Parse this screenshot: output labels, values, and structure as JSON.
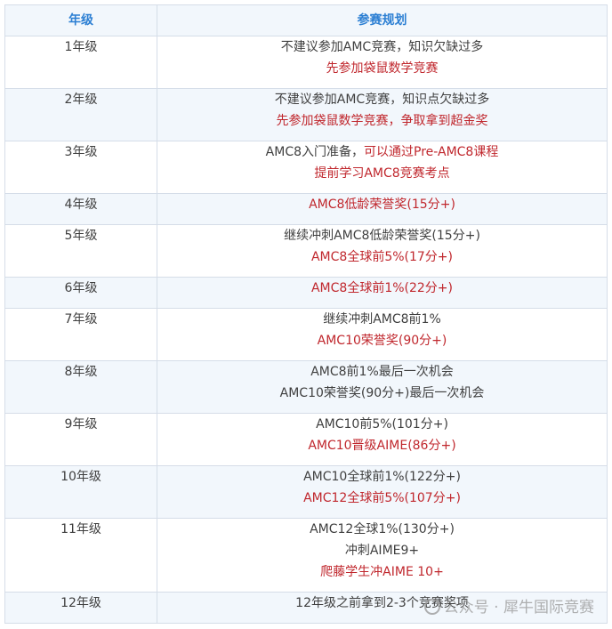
{
  "table": {
    "headers": [
      "年级",
      "参赛规划"
    ],
    "rows": [
      {
        "grade": "1年级",
        "lines": [
          {
            "parts": [
              {
                "text": "不建议参加AMC竞赛，知识欠缺过多",
                "red": false
              }
            ]
          },
          {
            "parts": [
              {
                "text": "先参加袋鼠数学竞赛",
                "red": true
              }
            ]
          }
        ]
      },
      {
        "grade": "2年级",
        "lines": [
          {
            "parts": [
              {
                "text": "不建议参加AMC竞赛，知识点欠缺过多",
                "red": false
              }
            ]
          },
          {
            "parts": [
              {
                "text": "先参加袋鼠数学竞赛，争取拿到超金奖",
                "red": true
              }
            ]
          }
        ]
      },
      {
        "grade": "3年级",
        "lines": [
          {
            "parts": [
              {
                "text": "AMC8入门准备，",
                "red": false
              },
              {
                "text": "可以通过Pre-AMC8课程",
                "red": true
              }
            ]
          },
          {
            "parts": [
              {
                "text": "提前学习AMC8竞赛考点",
                "red": true
              }
            ]
          }
        ]
      },
      {
        "grade": "4年级",
        "lines": [
          {
            "parts": [
              {
                "text": "AMC8低龄荣誉奖(15分+)",
                "red": true
              }
            ]
          }
        ]
      },
      {
        "grade": "5年级",
        "lines": [
          {
            "parts": [
              {
                "text": "继续冲刺AMC8低龄荣誉奖(15分+)",
                "red": false
              }
            ]
          },
          {
            "parts": [
              {
                "text": "AMC8全球前5%(17分+)",
                "red": true
              }
            ]
          }
        ]
      },
      {
        "grade": "6年级",
        "lines": [
          {
            "parts": [
              {
                "text": "AMC8全球前1%(22分+)",
                "red": true
              }
            ]
          }
        ]
      },
      {
        "grade": "7年级",
        "lines": [
          {
            "parts": [
              {
                "text": "继续冲刺AMC8前1%",
                "red": false
              }
            ]
          },
          {
            "parts": [
              {
                "text": "AMC10荣誉奖(90分+)",
                "red": true
              }
            ]
          }
        ]
      },
      {
        "grade": "8年级",
        "lines": [
          {
            "parts": [
              {
                "text": "AMC8前1%最后一次机会",
                "red": false
              }
            ]
          },
          {
            "parts": [
              {
                "text": "AMC10荣誉奖(90分+)最后一次机会",
                "red": false
              }
            ]
          }
        ]
      },
      {
        "grade": "9年级",
        "lines": [
          {
            "parts": [
              {
                "text": "AMC10前5%(101分+)",
                "red": false
              }
            ]
          },
          {
            "parts": [
              {
                "text": "AMC10晋级AIME(86分+)",
                "red": true
              }
            ]
          }
        ]
      },
      {
        "grade": "10年级",
        "lines": [
          {
            "parts": [
              {
                "text": "AMC10全球前1%(122分+)",
                "red": false
              }
            ]
          },
          {
            "parts": [
              {
                "text": "AMC12全球前5%(107分+)",
                "red": true
              }
            ]
          }
        ]
      },
      {
        "grade": "11年级",
        "lines": [
          {
            "parts": [
              {
                "text": "AMC12全球1%(130分+)",
                "red": false
              }
            ]
          },
          {
            "parts": [
              {
                "text": "冲刺AIME9+",
                "red": false
              }
            ]
          },
          {
            "parts": [
              {
                "text": "爬藤学生冲AIME 10+",
                "red": true
              }
            ]
          }
        ]
      },
      {
        "grade": "12年级",
        "lines": [
          {
            "parts": [
              {
                "text": "12年级之前拿到2-3个竞赛奖项",
                "red": false
              }
            ]
          }
        ]
      }
    ]
  },
  "watermark": {
    "icon": "wechat-icon",
    "text": "公众号 · 犀牛国际竞赛"
  },
  "colors": {
    "header_text": "#2c7fd3",
    "highlight_red": "#c0272d",
    "row_alt_bg": "#f2f7fc",
    "border": "#d5dde8"
  }
}
